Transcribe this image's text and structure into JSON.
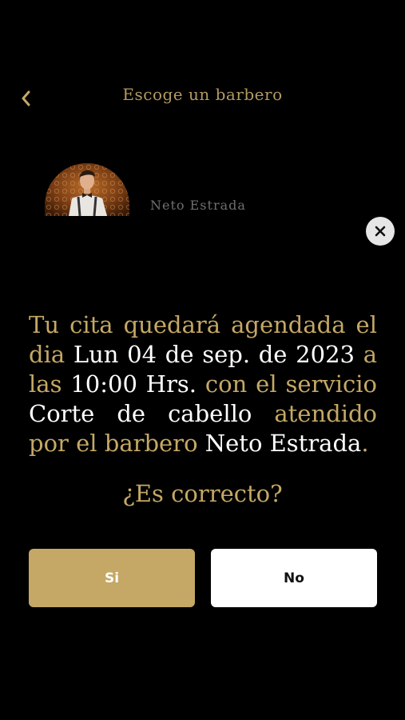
{
  "header": {
    "title": "Escoge un barbero",
    "back_icon": "chevron-left-icon"
  },
  "barber": {
    "name": "Neto Estrada"
  },
  "dialog": {
    "close_icon": "close-icon",
    "message": {
      "p1": "Tu cita quedará agendada el dia ",
      "date": "Lun 04 de sep. de 2023",
      "p2": " a las ",
      "time": "10:00 Hrs.",
      "p3": " con el servicio ",
      "service": "Corte de cabello",
      "p4": " atendido por el barbero ",
      "barber": "Neto Estrada",
      "p5": "."
    },
    "question": "¿Es correcto?",
    "yes_label": "Si",
    "no_label": "No"
  },
  "colors": {
    "accent": "#c5a865",
    "background": "#000000",
    "highlight_text": "#ffffff",
    "muted_text": "#6f6f6f"
  }
}
